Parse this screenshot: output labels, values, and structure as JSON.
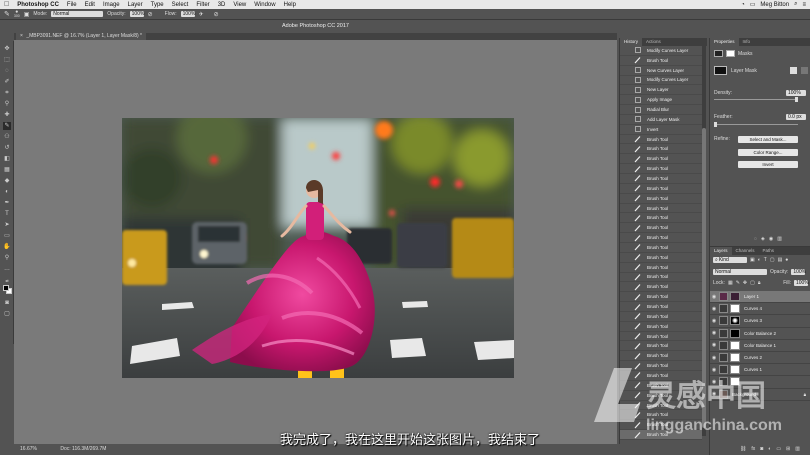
{
  "menubar": {
    "app_name": "Photoshop CC",
    "items": [
      "File",
      "Edit",
      "Image",
      "Layer",
      "Type",
      "Select",
      "Filter",
      "3D",
      "View",
      "Window",
      "Help"
    ],
    "user": "Meg Bitton"
  },
  "window_title": "Adobe Photoshop CC 2017",
  "options": {
    "brush_size": "300",
    "mode_label": "Mode:",
    "mode_value": "Normal",
    "opacity_label": "Opacity:",
    "opacity_value": "100%",
    "flow_label": "Flow:",
    "flow_value": "100%"
  },
  "document_tab": "_MBP3091.NEF @ 16.7% (Layer 1, Layer Mask/8) *",
  "status": {
    "zoom": "16.67%",
    "doc": "Doc: 116.3M/269.7M"
  },
  "subtitle": "我完成了，我在这里开始这张图片，我结束了",
  "history": {
    "tabs": [
      "History",
      "Actions"
    ],
    "items": [
      "Modify Curves Layer",
      "Brush Tool",
      "New Curves Layer",
      "Modify Curves Layer",
      "New Layer",
      "Apply Image",
      "Radial Blur",
      "Add Layer Mask",
      "Invert",
      "Brush Tool",
      "Brush Tool",
      "Brush Tool",
      "Brush Tool",
      "Brush Tool",
      "Brush Tool",
      "Brush Tool",
      "Brush Tool",
      "Brush Tool",
      "Brush Tool",
      "Brush Tool",
      "Brush Tool",
      "Brush Tool",
      "Brush Tool",
      "Brush Tool",
      "Brush Tool",
      "Brush Tool",
      "Brush Tool",
      "Brush Tool",
      "Brush Tool",
      "Brush Tool",
      "Brush Tool",
      "Brush Tool",
      "Brush Tool",
      "Brush Tool",
      "Brush Tool",
      "Brush Tool",
      "Brush Tool",
      "Brush Tool",
      "Brush Tool",
      "Brush Tool"
    ]
  },
  "properties": {
    "tabs": [
      "Properties",
      "Info"
    ],
    "masks_label": "Masks",
    "layer_mask_label": "Layer Mask",
    "density_label": "Density:",
    "density_value": "100%",
    "density_level": 1.0,
    "feather_label": "Feather:",
    "feather_value": "0.0 px",
    "refine_label": "Refine:",
    "btn_select_mask": "Select and Mask...",
    "btn_color_range": "Color Range...",
    "btn_invert": "Invert"
  },
  "layers": {
    "tabs": [
      "Layers",
      "Channels",
      "Paths"
    ],
    "kind_label": "Kind",
    "blend_mode": "Normal",
    "opacity_label": "Opacity:",
    "opacity_value": "100%",
    "lock_label": "Lock:",
    "fill_label": "Fill:",
    "fill_value": "100%",
    "items": [
      "Layer 1",
      "Curves 4",
      "Curves 3",
      "Color Balance 2",
      "Color Balance 1",
      "Curves 2",
      "Curves 1",
      "",
      "Background"
    ]
  },
  "watermark": {
    "brand": "灵感中国",
    "url": "lingganchina.com"
  },
  "colors": {
    "accent": "#ff6a00",
    "dress": "#d6207a",
    "selected": "#6b6b6b"
  }
}
